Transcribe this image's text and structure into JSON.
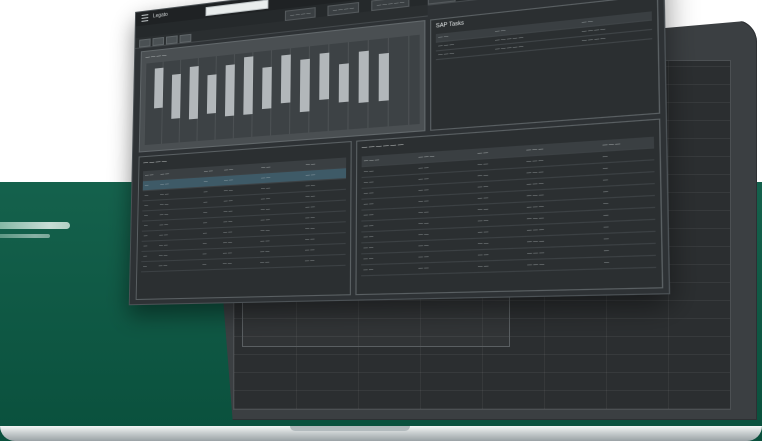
{
  "colors": {
    "band": "#0b5b45",
    "window_bg": "#2e3235",
    "laptop_bezel": "#3b3f42"
  },
  "app": {
    "title": "Legato",
    "subtitle": "— —",
    "menu_icon": "hamburger-icon"
  },
  "tabs": [
    "— — — —",
    "— — — —",
    "— — — — —",
    "— — —",
    "— — — — —"
  ],
  "panels": {
    "schedule": {
      "title": "— — — —"
    },
    "list": {
      "title": "SAP Tasks",
      "columns": [
        "— —",
        "— —",
        "— —"
      ],
      "rows": [
        [
          "— — —",
          "— — — — —",
          "— — — —"
        ],
        [
          "— — —",
          "— — — — —",
          "— — — —"
        ]
      ]
    },
    "orders": {
      "title": "— — — —",
      "columns": [
        "— —",
        "— —",
        "— —",
        "— —",
        "— —",
        "— —"
      ],
      "rows": [
        [
          "—",
          "— —",
          "—",
          "— —",
          "— —",
          "— —"
        ],
        [
          "—",
          "— —",
          "—",
          "— —",
          "— —",
          "— —"
        ],
        [
          "—",
          "— —",
          "—",
          "— —",
          "— —",
          "— —"
        ],
        [
          "—",
          "— —",
          "—",
          "— —",
          "— —",
          "— —"
        ],
        [
          "—",
          "— —",
          "—",
          "— —",
          "— —",
          "— —"
        ],
        [
          "—",
          "— —",
          "—",
          "— —",
          "— —",
          "— —"
        ],
        [
          "—",
          "— —",
          "—",
          "— —",
          "— —",
          "— —"
        ],
        [
          "—",
          "— —",
          "—",
          "— —",
          "— —",
          "— —"
        ],
        [
          "—",
          "— —",
          "—",
          "— —",
          "— —",
          "— —"
        ]
      ]
    },
    "details": {
      "title": "— — — — — —",
      "columns": [
        "— — —",
        "— — —",
        "— —",
        "— — —",
        "— — —"
      ],
      "rows": [
        [
          "— —",
          "— —",
          "— —",
          "— — —",
          "—"
        ],
        [
          "— —",
          "— —",
          "— —",
          "— — —",
          "—"
        ],
        [
          "— —",
          "— —",
          "— —",
          "— — —",
          "—"
        ],
        [
          "— —",
          "— —",
          "— —",
          "— — —",
          "—"
        ],
        [
          "— —",
          "— —",
          "— —",
          "— — —",
          "—"
        ],
        [
          "— —",
          "— —",
          "— —",
          "— — —",
          "—"
        ],
        [
          "— —",
          "— —",
          "— —",
          "— — —",
          "—"
        ],
        [
          "— —",
          "— —",
          "— —",
          "— — —",
          "—"
        ],
        [
          "— —",
          "— —",
          "— —",
          "— — —",
          "—"
        ],
        [
          "— —",
          "— —",
          "— —",
          "— — —",
          "—"
        ]
      ]
    }
  }
}
